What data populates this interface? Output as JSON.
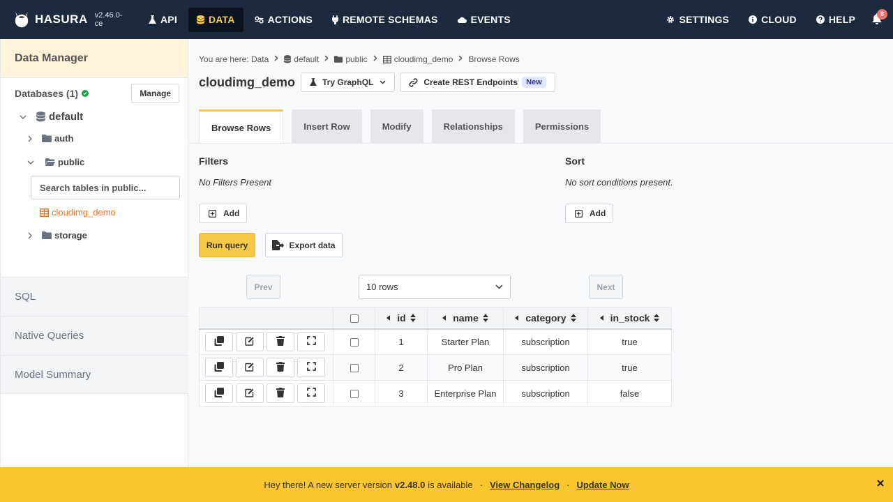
{
  "app": {
    "logo_text": "HASURA",
    "version": "v2.46.0-ce"
  },
  "nav": {
    "left": [
      {
        "label": "API",
        "icon": "flask-icon"
      },
      {
        "label": "DATA",
        "icon": "database-icon",
        "active": true
      },
      {
        "label": "ACTIONS",
        "icon": "actions-icon"
      },
      {
        "label": "REMOTE SCHEMAS",
        "icon": "plug-icon"
      },
      {
        "label": "EVENTS",
        "icon": "cloud-icon"
      }
    ],
    "right": [
      {
        "label": "SETTINGS",
        "icon": "gear-icon"
      },
      {
        "label": "CLOUD",
        "icon": "info-icon"
      },
      {
        "label": "HELP",
        "icon": "question-icon"
      }
    ],
    "notification_count": "8"
  },
  "sidebar": {
    "header": "Data Manager",
    "databases_label": "Databases (1)",
    "manage_label": "Manage",
    "db_name": "default",
    "schemas": [
      "auth",
      "public",
      "storage"
    ],
    "search_placeholder": "Search tables in public...",
    "active_table": "cloudimg_demo",
    "sections": [
      "SQL",
      "Native Queries",
      "Model Summary"
    ]
  },
  "breadcrumb": {
    "prefix": "You are here: Data",
    "items": [
      "default",
      "public",
      "cloudimg_demo",
      "Browse Rows"
    ]
  },
  "header": {
    "title": "cloudimg_demo",
    "graphql_label": "Try GraphQL",
    "rest_label": "Create REST Endpoints",
    "new_badge": "New"
  },
  "tabs": [
    "Browse Rows",
    "Insert Row",
    "Modify",
    "Relationships",
    "Permissions"
  ],
  "filters": {
    "title": "Filters",
    "empty": "No Filters Present",
    "add_label": "Add"
  },
  "sort": {
    "title": "Sort",
    "empty": "No sort conditions present.",
    "add_label": "Add"
  },
  "actions": {
    "run_label": "Run query",
    "export_label": "Export data"
  },
  "pagination": {
    "prev_label": "Prev",
    "next_label": "Next",
    "rows_value": "10 rows"
  },
  "table": {
    "columns": [
      "id",
      "name",
      "category",
      "in_stock"
    ],
    "rows": [
      [
        "1",
        "Starter Plan",
        "subscription",
        "true"
      ],
      [
        "2",
        "Pro Plan",
        "subscription",
        "true"
      ],
      [
        "3",
        "Enterprise Plan",
        "subscription",
        "false"
      ]
    ]
  },
  "banner": {
    "prefix": "Hey there! A new server version",
    "version": "v2.48.0",
    "suffix": "is available",
    "changelog_label": "View Changelog",
    "update_label": "Update Now"
  },
  "colors": {
    "nav_bg": "#1c2a3d",
    "accent": "#f7c948",
    "active_table": "#f97316",
    "banner_bg": "#fbc52d"
  }
}
